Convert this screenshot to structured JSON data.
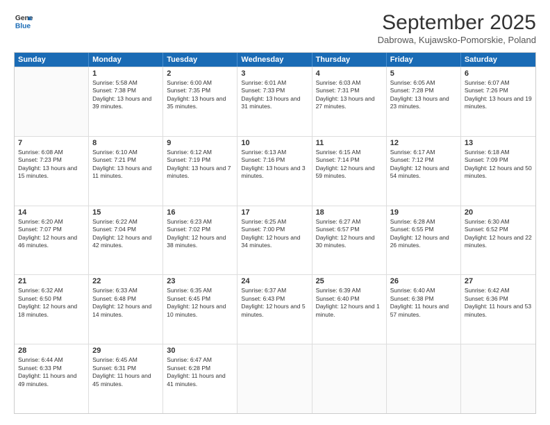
{
  "header": {
    "logo_line1": "General",
    "logo_line2": "Blue",
    "month": "September 2025",
    "location": "Dabrowa, Kujawsko-Pomorskie, Poland"
  },
  "days_of_week": [
    "Sunday",
    "Monday",
    "Tuesday",
    "Wednesday",
    "Thursday",
    "Friday",
    "Saturday"
  ],
  "weeks": [
    [
      {
        "day": "",
        "empty": true
      },
      {
        "day": "1",
        "sunrise": "5:58 AM",
        "sunset": "7:38 PM",
        "daylight": "13 hours and 39 minutes."
      },
      {
        "day": "2",
        "sunrise": "6:00 AM",
        "sunset": "7:35 PM",
        "daylight": "13 hours and 35 minutes."
      },
      {
        "day": "3",
        "sunrise": "6:01 AM",
        "sunset": "7:33 PM",
        "daylight": "13 hours and 31 minutes."
      },
      {
        "day": "4",
        "sunrise": "6:03 AM",
        "sunset": "7:31 PM",
        "daylight": "13 hours and 27 minutes."
      },
      {
        "day": "5",
        "sunrise": "6:05 AM",
        "sunset": "7:28 PM",
        "daylight": "13 hours and 23 minutes."
      },
      {
        "day": "6",
        "sunrise": "6:07 AM",
        "sunset": "7:26 PM",
        "daylight": "13 hours and 19 minutes."
      }
    ],
    [
      {
        "day": "7",
        "sunrise": "6:08 AM",
        "sunset": "7:23 PM",
        "daylight": "13 hours and 15 minutes."
      },
      {
        "day": "8",
        "sunrise": "6:10 AM",
        "sunset": "7:21 PM",
        "daylight": "13 hours and 11 minutes."
      },
      {
        "day": "9",
        "sunrise": "6:12 AM",
        "sunset": "7:19 PM",
        "daylight": "13 hours and 7 minutes."
      },
      {
        "day": "10",
        "sunrise": "6:13 AM",
        "sunset": "7:16 PM",
        "daylight": "13 hours and 3 minutes."
      },
      {
        "day": "11",
        "sunrise": "6:15 AM",
        "sunset": "7:14 PM",
        "daylight": "12 hours and 59 minutes."
      },
      {
        "day": "12",
        "sunrise": "6:17 AM",
        "sunset": "7:12 PM",
        "daylight": "12 hours and 54 minutes."
      },
      {
        "day": "13",
        "sunrise": "6:18 AM",
        "sunset": "7:09 PM",
        "daylight": "12 hours and 50 minutes."
      }
    ],
    [
      {
        "day": "14",
        "sunrise": "6:20 AM",
        "sunset": "7:07 PM",
        "daylight": "12 hours and 46 minutes."
      },
      {
        "day": "15",
        "sunrise": "6:22 AM",
        "sunset": "7:04 PM",
        "daylight": "12 hours and 42 minutes."
      },
      {
        "day": "16",
        "sunrise": "6:23 AM",
        "sunset": "7:02 PM",
        "daylight": "12 hours and 38 minutes."
      },
      {
        "day": "17",
        "sunrise": "6:25 AM",
        "sunset": "7:00 PM",
        "daylight": "12 hours and 34 minutes."
      },
      {
        "day": "18",
        "sunrise": "6:27 AM",
        "sunset": "6:57 PM",
        "daylight": "12 hours and 30 minutes."
      },
      {
        "day": "19",
        "sunrise": "6:28 AM",
        "sunset": "6:55 PM",
        "daylight": "12 hours and 26 minutes."
      },
      {
        "day": "20",
        "sunrise": "6:30 AM",
        "sunset": "6:52 PM",
        "daylight": "12 hours and 22 minutes."
      }
    ],
    [
      {
        "day": "21",
        "sunrise": "6:32 AM",
        "sunset": "6:50 PM",
        "daylight": "12 hours and 18 minutes."
      },
      {
        "day": "22",
        "sunrise": "6:33 AM",
        "sunset": "6:48 PM",
        "daylight": "12 hours and 14 minutes."
      },
      {
        "day": "23",
        "sunrise": "6:35 AM",
        "sunset": "6:45 PM",
        "daylight": "12 hours and 10 minutes."
      },
      {
        "day": "24",
        "sunrise": "6:37 AM",
        "sunset": "6:43 PM",
        "daylight": "12 hours and 5 minutes."
      },
      {
        "day": "25",
        "sunrise": "6:39 AM",
        "sunset": "6:40 PM",
        "daylight": "12 hours and 1 minute."
      },
      {
        "day": "26",
        "sunrise": "6:40 AM",
        "sunset": "6:38 PM",
        "daylight": "11 hours and 57 minutes."
      },
      {
        "day": "27",
        "sunrise": "6:42 AM",
        "sunset": "6:36 PM",
        "daylight": "11 hours and 53 minutes."
      }
    ],
    [
      {
        "day": "28",
        "sunrise": "6:44 AM",
        "sunset": "6:33 PM",
        "daylight": "11 hours and 49 minutes."
      },
      {
        "day": "29",
        "sunrise": "6:45 AM",
        "sunset": "6:31 PM",
        "daylight": "11 hours and 45 minutes."
      },
      {
        "day": "30",
        "sunrise": "6:47 AM",
        "sunset": "6:28 PM",
        "daylight": "11 hours and 41 minutes."
      },
      {
        "day": "",
        "empty": true
      },
      {
        "day": "",
        "empty": true
      },
      {
        "day": "",
        "empty": true
      },
      {
        "day": "",
        "empty": true
      }
    ]
  ]
}
